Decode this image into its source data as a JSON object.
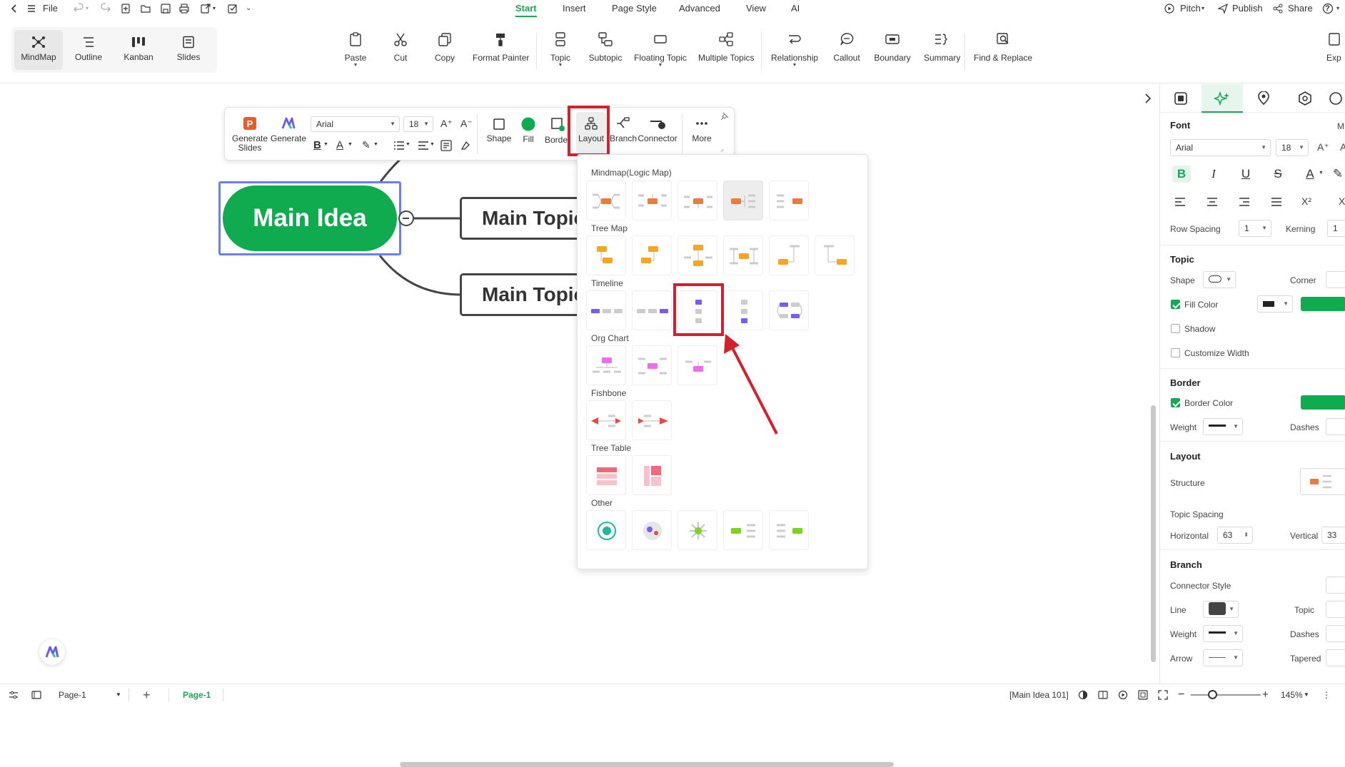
{
  "topbar": {
    "file_label": "File",
    "tabs": [
      {
        "label": "Start",
        "active": true
      },
      {
        "label": "Insert"
      },
      {
        "label": "Page Style"
      },
      {
        "label": "Advanced"
      },
      {
        "label": "View"
      },
      {
        "label": "AI"
      }
    ],
    "pitch_label": "Pitch",
    "publish_label": "Publish",
    "share_label": "Share",
    "help_label": "?"
  },
  "views": [
    "MindMap",
    "Outline",
    "Kanban",
    "Slides"
  ],
  "ribbon": {
    "paste": "Paste",
    "cut": "Cut",
    "copy": "Copy",
    "format_painter": "Format Painter",
    "topic": "Topic",
    "subtopic": "Subtopic",
    "floating_topic": "Floating Topic",
    "multiple_topics": "Multiple Topics",
    "relationship": "Relationship",
    "callout": "Callout",
    "boundary": "Boundary",
    "summary": "Summary",
    "find_replace": "Find & Replace",
    "export": "Exp"
  },
  "canvas": {
    "main_idea": "Main Idea",
    "topic1": "Main Topic",
    "topic2": "Main Topic"
  },
  "floatbar": {
    "generate_slides": "Generate Slides",
    "generate": "Generate",
    "font": "Arial",
    "size": "18",
    "shape": "Shape",
    "fill": "Fill",
    "border": "Border",
    "layout": "Layout",
    "branch": "Branch",
    "connector": "Connector",
    "more": "More"
  },
  "layout_panel": {
    "sections": [
      "Mindmap(Logic Map)",
      "Tree Map",
      "Timeline",
      "Org Chart",
      "Fishbone",
      "Tree Table",
      "Other"
    ]
  },
  "right_panel": {
    "font_heading": "Font",
    "font_more": "M",
    "font_name": "Arial",
    "font_size": "18",
    "row_spacing_label": "Row Spacing",
    "row_spacing_value": "1",
    "kerning_label": "Kerning",
    "kerning_value": "1",
    "topic_heading": "Topic",
    "shape_label": "Shape",
    "corner_label": "Corner",
    "fill_color_label": "Fill Color",
    "shadow_label": "Shadow",
    "customize_width_label": "Customize Width",
    "border_heading": "Border",
    "border_color_label": "Border Color",
    "weight_label": "Weight",
    "dashes_label": "Dashes",
    "layout_heading": "Layout",
    "structure_label": "Structure",
    "topic_spacing_label": "Topic Spacing",
    "horizontal_label": "Horizontal",
    "horizontal_value": "63",
    "vertical_label": "Vertical",
    "vertical_value": "33",
    "branch_heading": "Branch",
    "connector_style_label": "Connector Style",
    "line_label": "Line",
    "topic_label": "Topic",
    "weight2_label": "Weight",
    "dashes2_label": "Dashes",
    "arrow_label": "Arrow",
    "tapered_label": "Tapered"
  },
  "statusbar": {
    "page_select": "Page-1",
    "page_tab": "Page-1",
    "selection_info": "[Main Idea 101]",
    "zoom": "145%"
  },
  "colors": {
    "accent": "#1ba657",
    "main_idea_fill": "#0fab4e",
    "highlight": "#d81e2c",
    "selection": "#6b7ff0"
  }
}
